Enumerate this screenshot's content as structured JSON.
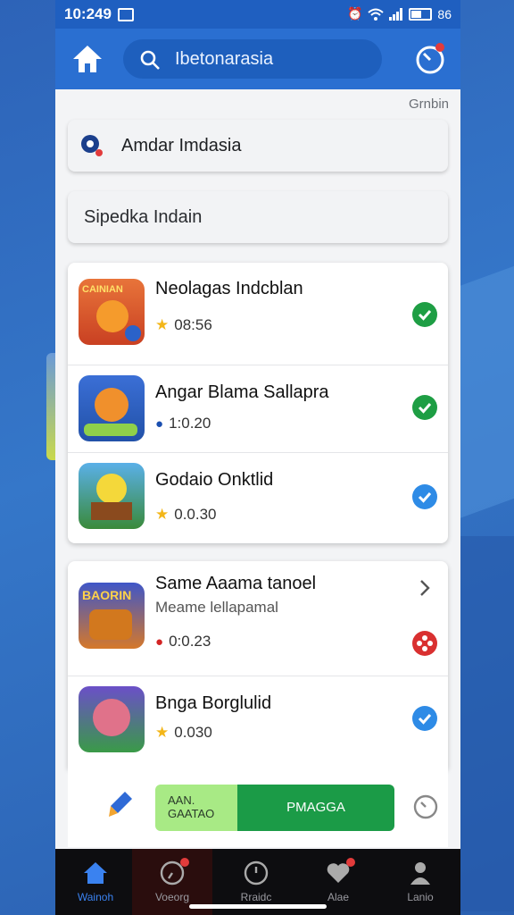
{
  "status": {
    "time": "10:249",
    "right": "86"
  },
  "appbar": {
    "search_text": "Ibetonarasia"
  },
  "header_link": "Grnbin",
  "fields": {
    "location_text": "Amdar Imdasia",
    "secondary_text": "Sipedka Indain"
  },
  "list1": [
    {
      "title": "Neolagas Indcblan",
      "meta": "08:56",
      "meta_icon": "star-icon",
      "status": "check-green"
    },
    {
      "title": "Angar Blama Sallapra",
      "meta": "1:0.20",
      "meta_icon": "pin-icon",
      "status": "check-green"
    },
    {
      "title": "Godaio Onktlid",
      "meta": "0.0.30",
      "meta_icon": "star-icon",
      "status": "check-blue"
    }
  ],
  "list2": [
    {
      "title": "Same Aaama tanoel",
      "subtitle": "Meame lellapamal",
      "meta": "0:0.23",
      "meta_icon": "record-icon",
      "status": "chevron"
    },
    {
      "title": "Bnga Borglulid",
      "meta": "0.030",
      "meta_icon": "star-icon",
      "status": "check-blue"
    }
  ],
  "thumb_labels": {
    "t1": "CAINIAN",
    "t4": "BAORIN"
  },
  "segment": {
    "left_line1": "AAN.",
    "left_line2": "GAATAO",
    "right_label": "PMAGGA"
  },
  "nav": [
    {
      "label": "Wainoh",
      "icon": "home-icon"
    },
    {
      "label": "Voeorg",
      "icon": "compass-icon"
    },
    {
      "label": "Rraidc",
      "icon": "clock-icon"
    },
    {
      "label": "Alae",
      "icon": "heart-icon"
    },
    {
      "label": "Lanio",
      "icon": "person-icon"
    }
  ],
  "colors": {
    "primary": "#2a6fd1",
    "check_green": "#1e9e44",
    "check_blue": "#2e8be6",
    "nav_active": "#3a82f0"
  }
}
